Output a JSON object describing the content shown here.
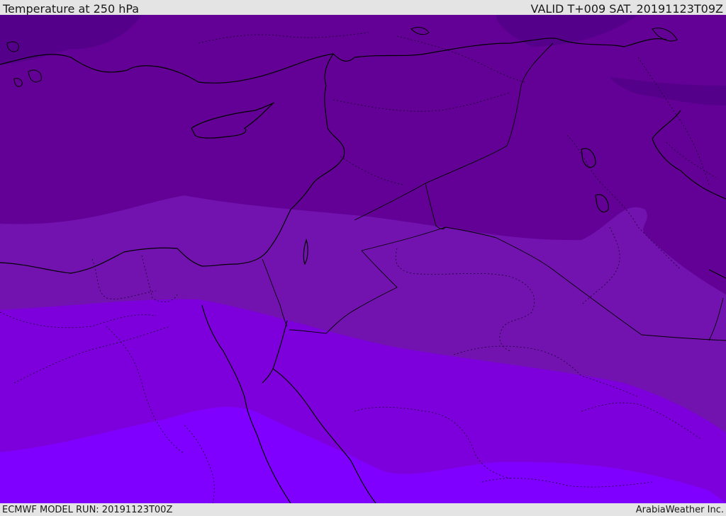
{
  "header": {
    "title": "Temperature at 250 hPa",
    "valid": "VALID T+009 SAT. 20191123T09Z"
  },
  "footer": {
    "model_run": "ECMWF MODEL RUN: 20191123T00Z",
    "credit": "ArabiaWeather Inc."
  },
  "colors": {
    "band_darkest": "#55008a",
    "band_dark": "#630095",
    "band_mid": "#7213b0",
    "band_light": "#7d00dc",
    "band_lightest": "#7f00ff",
    "coastline": "#000000",
    "border": "#1a0030"
  }
}
